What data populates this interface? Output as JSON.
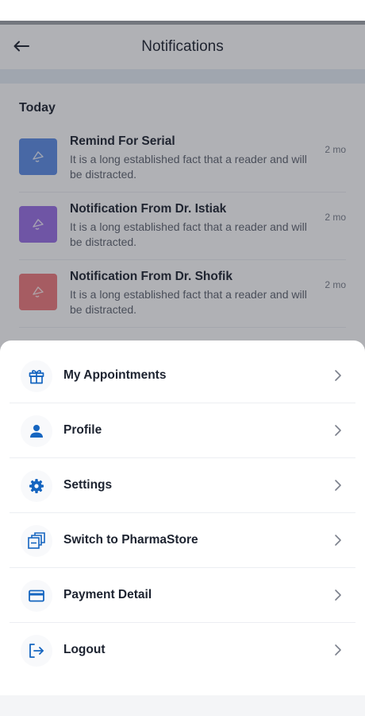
{
  "header": {
    "title": "Notifications"
  },
  "section": {
    "title": "Today"
  },
  "notifications": [
    {
      "title": "Remind For Serial",
      "body": "It is a long established fact that a reader and will be distracted.",
      "time": "2 mo",
      "color": "#5d8de6"
    },
    {
      "title": "Notification From Dr. Istiak",
      "body": "It is a long established fact that a reader and will be distracted.",
      "time": "2 mo",
      "color": "#9a6fe6"
    },
    {
      "title": "Notification From Dr. Shofik",
      "body": "It is a long established fact that a reader and will be distracted.",
      "time": "2 mo",
      "color": "#f07b7d"
    }
  ],
  "menu": {
    "items": [
      {
        "label": "My Appointments",
        "icon": "gift-icon"
      },
      {
        "label": "Profile",
        "icon": "person-icon"
      },
      {
        "label": "Settings",
        "icon": "gear-icon"
      },
      {
        "label": "Switch to PharmaStore",
        "icon": "stack-icon"
      },
      {
        "label": "Payment Detail",
        "icon": "card-icon"
      },
      {
        "label": "Logout",
        "icon": "logout-icon"
      }
    ]
  },
  "colors": {
    "accent": "#1565c0",
    "text": "#1d2330",
    "muted": "#5f6470",
    "overlay": "rgba(35,40,50,0.36)"
  }
}
